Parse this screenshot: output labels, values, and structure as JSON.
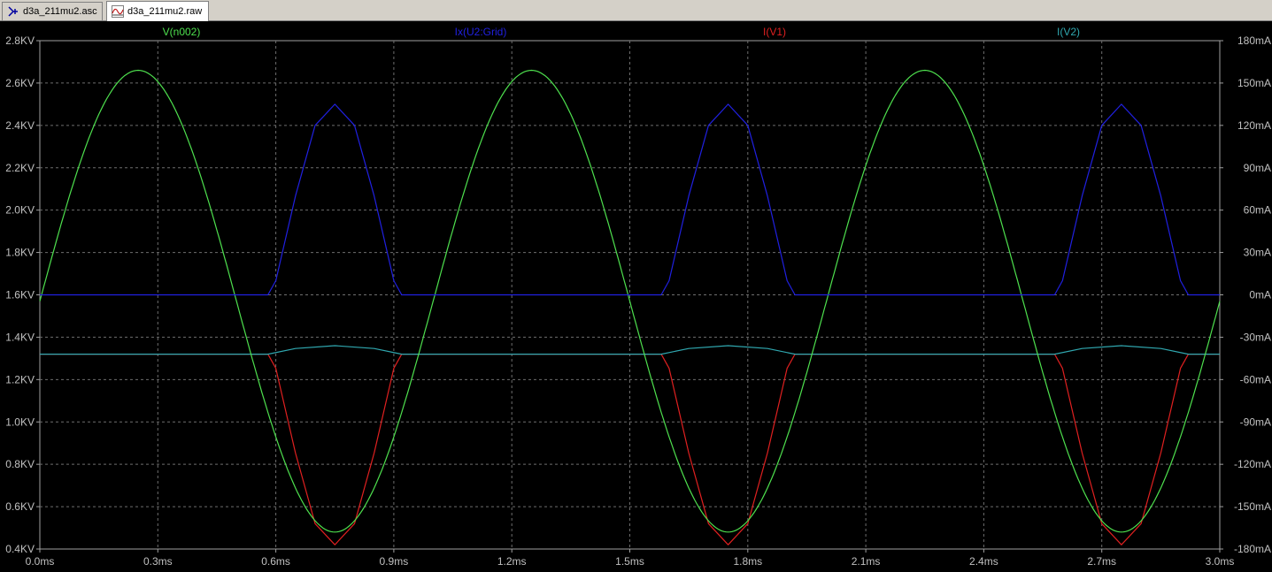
{
  "tabs": [
    {
      "label": "d3a_211mu2.asc",
      "icon": "schematic-icon",
      "active": false
    },
    {
      "label": "d3a_211mu2.raw",
      "icon": "waveform-icon",
      "active": true
    }
  ],
  "colors": {
    "background": "#000000",
    "grid": "#6e6e6e",
    "axis_text": "#c0c0c0",
    "v_n002": "#4ee04e",
    "ix_grid": "#2020e0",
    "i_v1": "#e02020",
    "i_v2": "#30a8b0"
  },
  "chart_data": {
    "type": "line",
    "title": "",
    "grid": true,
    "x_axis": {
      "range": [
        0.0,
        3.0
      ],
      "unit": "ms",
      "ticks": [
        "0.0ms",
        "0.3ms",
        "0.6ms",
        "0.9ms",
        "1.2ms",
        "1.5ms",
        "1.8ms",
        "2.1ms",
        "2.4ms",
        "2.7ms",
        "3.0ms"
      ]
    },
    "y_left": {
      "range": [
        0.4,
        2.8
      ],
      "unit": "KV",
      "ticks": [
        "2.8KV",
        "2.6KV",
        "2.4KV",
        "2.2KV",
        "2.0KV",
        "1.8KV",
        "1.6KV",
        "1.4KV",
        "1.2KV",
        "1.0KV",
        "0.8KV",
        "0.6KV",
        "0.4KV"
      ]
    },
    "y_right": {
      "range": [
        -180,
        180
      ],
      "unit": "mA",
      "ticks": [
        "180mA",
        "150mA",
        "120mA",
        "90mA",
        "60mA",
        "30mA",
        "0mA",
        "-30mA",
        "-60mA",
        "-90mA",
        "-120mA",
        "-150mA",
        "-180mA"
      ]
    },
    "series": [
      {
        "name": "V(n002)",
        "axis": "left",
        "color": "#4ee04e",
        "x": [
          0,
          0.1,
          0.2,
          0.25,
          0.3,
          0.4,
          0.5,
          0.6,
          0.7,
          0.75,
          0.8,
          0.9,
          1.0,
          1.1,
          1.2,
          1.25,
          1.3,
          1.4,
          1.5,
          1.6,
          1.7,
          1.75,
          1.8,
          1.9,
          2.0,
          2.1,
          2.2,
          2.25,
          2.3,
          2.4,
          2.5,
          2.6,
          2.7,
          2.75,
          2.8,
          2.9,
          3.0
        ],
        "y": [
          1.6,
          2.22,
          2.6,
          2.66,
          2.6,
          2.22,
          1.6,
          0.98,
          0.6,
          0.48,
          0.6,
          0.98,
          1.6,
          2.22,
          2.6,
          2.66,
          2.6,
          2.22,
          1.6,
          0.98,
          0.6,
          0.48,
          0.6,
          0.98,
          1.6,
          2.22,
          2.6,
          2.66,
          2.6,
          2.22,
          1.6,
          0.98,
          0.6,
          0.48,
          0.6,
          0.98,
          1.6
        ]
      },
      {
        "name": "Ix(U2:Grid)",
        "axis": "right",
        "color": "#2020e0",
        "x": [
          0,
          0.58,
          0.6,
          0.65,
          0.7,
          0.75,
          0.8,
          0.85,
          0.9,
          0.92,
          1.58,
          1.6,
          1.65,
          1.7,
          1.75,
          1.8,
          1.85,
          1.9,
          1.92,
          2.58,
          2.6,
          2.65,
          2.7,
          2.75,
          2.8,
          2.85,
          2.9,
          2.92,
          3.0
        ],
        "y": [
          0,
          0,
          10,
          70,
          120,
          135,
          120,
          70,
          10,
          0,
          0,
          10,
          70,
          120,
          135,
          120,
          70,
          10,
          0,
          0,
          10,
          70,
          120,
          135,
          120,
          70,
          10,
          0,
          0
        ]
      },
      {
        "name": "I(V1)",
        "axis": "right",
        "color": "#e02020",
        "x": [
          0,
          0.58,
          0.6,
          0.65,
          0.7,
          0.75,
          0.8,
          0.85,
          0.9,
          0.92,
          1.58,
          1.6,
          1.65,
          1.7,
          1.75,
          1.8,
          1.85,
          1.9,
          1.92,
          2.58,
          2.6,
          2.65,
          2.7,
          2.75,
          2.8,
          2.85,
          2.9,
          2.92,
          3.0
        ],
        "y": [
          -42,
          -42,
          -52,
          -112,
          -162,
          -177,
          -162,
          -112,
          -52,
          -42,
          -42,
          -52,
          -112,
          -162,
          -177,
          -162,
          -112,
          -52,
          -42,
          -42,
          -52,
          -112,
          -162,
          -177,
          -162,
          -112,
          -52,
          -42,
          -42
        ]
      },
      {
        "name": "I(V2)",
        "axis": "right",
        "color": "#30a8b0",
        "x": [
          0,
          0.58,
          0.65,
          0.75,
          0.85,
          0.92,
          1.58,
          1.65,
          1.75,
          1.85,
          1.92,
          2.58,
          2.65,
          2.75,
          2.85,
          2.92,
          3.0
        ],
        "y": [
          -42,
          -42,
          -38,
          -36,
          -38,
          -42,
          -42,
          -38,
          -36,
          -38,
          -42,
          -42,
          -38,
          -36,
          -38,
          -42,
          -42
        ]
      }
    ]
  }
}
